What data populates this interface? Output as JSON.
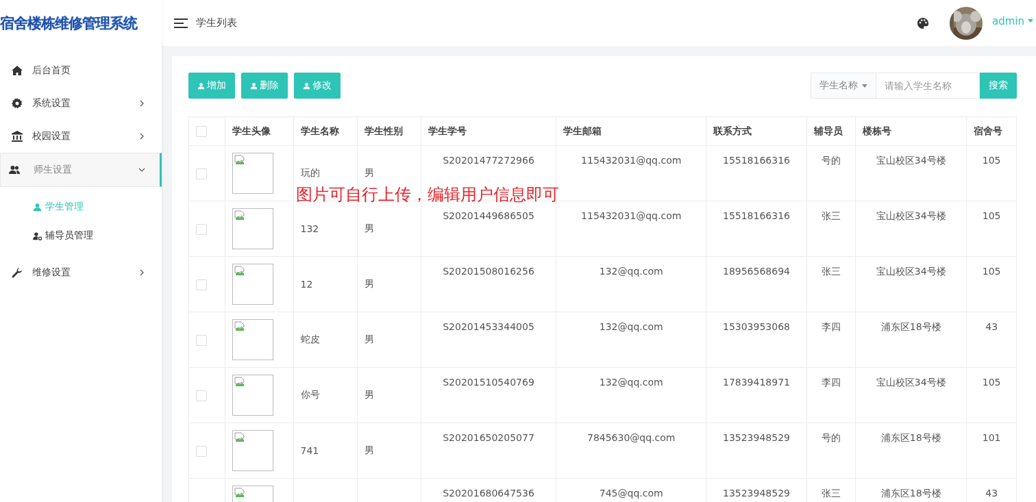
{
  "app_title": "宿舍楼栋维修管理系统",
  "header": {
    "page_title": "学生列表",
    "user": "admin"
  },
  "sidebar": {
    "items": [
      {
        "label": "后台首页",
        "selected": false
      },
      {
        "label": "系统设置",
        "expanded": false,
        "selected": false
      },
      {
        "label": "校园设置",
        "expanded": false,
        "selected": false
      },
      {
        "label": "师生设置",
        "expanded": true,
        "selected": true,
        "children": [
          {
            "label": "学生管理",
            "selected": true
          },
          {
            "label": "辅导员管理",
            "selected": false
          }
        ]
      },
      {
        "label": "维修设置",
        "expanded": false,
        "selected": false
      }
    ]
  },
  "toolbar": {
    "buttons": [
      {
        "label": "增加"
      },
      {
        "label": "删除"
      },
      {
        "label": "修改"
      }
    ],
    "search": {
      "field_select": "学生名称",
      "placeholder": "请输入学生名称",
      "button": "搜索"
    }
  },
  "table": {
    "columns": [
      "学生头像",
      "学生名称",
      "学生性别",
      "学生学号",
      "学生邮箱",
      "联系方式",
      "辅导员",
      "楼栋号",
      "宿舍号"
    ],
    "header_checked": false,
    "rows": [
      {
        "checked": false,
        "name": "玩的",
        "gender": "男",
        "number": "S20201477272966",
        "email": "115432031@qq.com",
        "phone": "15518166316",
        "counselor": "号的",
        "building": "宝山校区34号楼",
        "room": "105"
      },
      {
        "checked": false,
        "name": "132",
        "gender": "男",
        "number": "S20201449686505",
        "email": "115432031@qq.com",
        "phone": "15518166316",
        "counselor": "张三",
        "building": "宝山校区34号楼",
        "room": "105"
      },
      {
        "checked": false,
        "name": "12",
        "gender": "男",
        "number": "S20201508016256",
        "email": "132@qq.com",
        "phone": "18956568694",
        "counselor": "张三",
        "building": "宝山校区34号楼",
        "room": "105"
      },
      {
        "checked": false,
        "name": "蛇皮",
        "gender": "男",
        "number": "S20201453344005",
        "email": "132@qq.com",
        "phone": "15303953068",
        "counselor": "李四",
        "building": "浦东区18号楼",
        "room": "43"
      },
      {
        "checked": false,
        "name": "你号",
        "gender": "男",
        "number": "S20201510540769",
        "email": "132@qq.com",
        "phone": "17839418971",
        "counselor": "李四",
        "building": "宝山校区34号楼",
        "room": "105"
      },
      {
        "checked": false,
        "name": "741",
        "gender": "男",
        "number": "S20201650205077",
        "email": "7845630@qq.com",
        "phone": "13523948529",
        "counselor": "号的",
        "building": "浦东区18号楼",
        "room": "101"
      },
      {
        "number": "S20201680647536",
        "email": "745@qq.com",
        "phone": "13523948529",
        "counselor": "张三",
        "building": "浦东区18号楼",
        "room": "43"
      }
    ]
  },
  "annotation": "图片可自行上传，编辑用户信息即可"
}
